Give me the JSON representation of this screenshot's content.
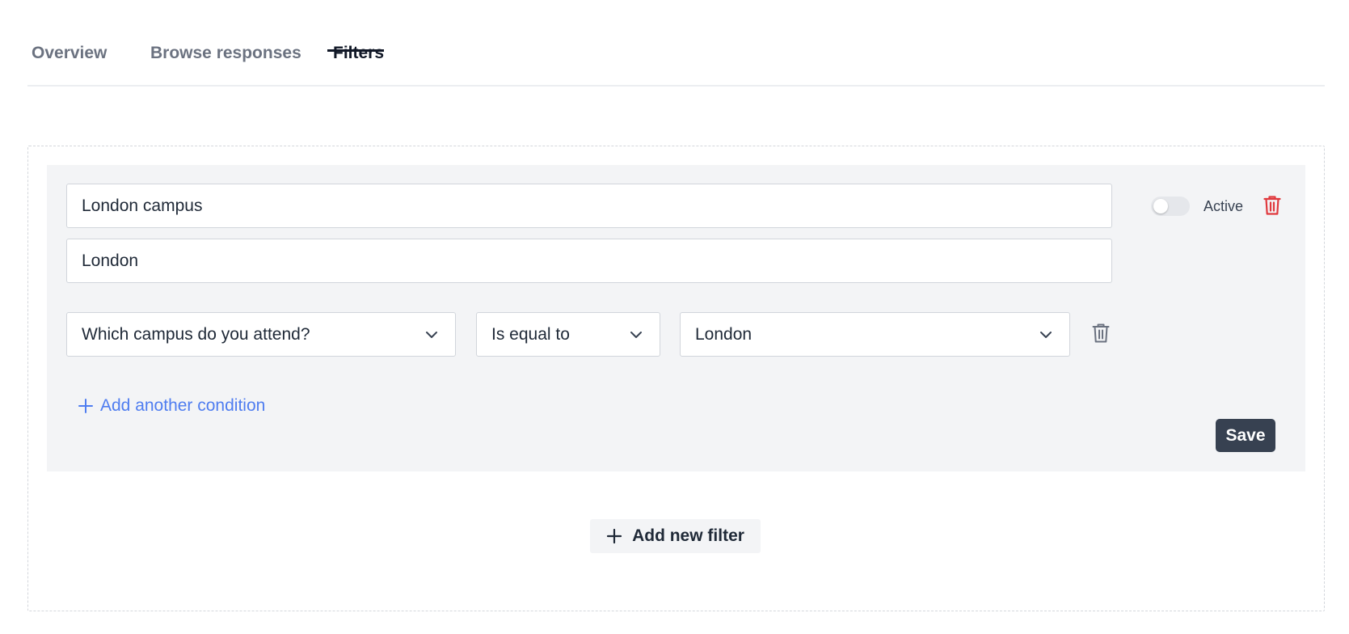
{
  "tabs": [
    {
      "label": "Overview"
    },
    {
      "label": "Browse responses"
    },
    {
      "label": "Filters",
      "active": true
    }
  ],
  "filter": {
    "name_value": "London campus",
    "description_value": "London",
    "active_label": "Active",
    "active": false,
    "condition": {
      "question": "Which campus do you attend?",
      "operator": "Is equal to",
      "value": "London"
    },
    "add_condition_label": "Add another condition",
    "save_label": "Save"
  },
  "add_filter_label": "Add new filter",
  "colors": {
    "accent_link": "#4f7df0",
    "delete_red": "#e0393e",
    "save_bg": "#374151",
    "card_bg": "#f3f4f6"
  },
  "icons": [
    "trash-icon",
    "chevron-down-icon",
    "plus-icon"
  ]
}
